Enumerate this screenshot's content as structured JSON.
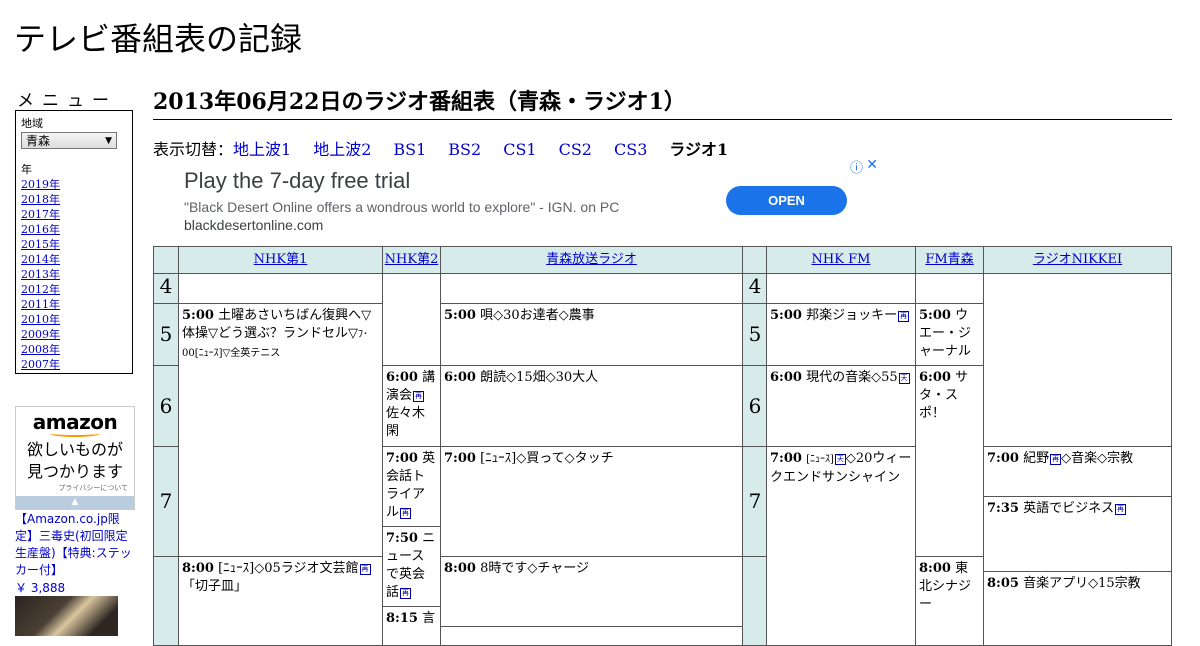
{
  "site_title": "テレビ番組表の記録",
  "menu": {
    "heading": "メニュー",
    "region_label": "地域",
    "region_value": "青森",
    "year_label": "年",
    "years": [
      "2019年",
      "2018年",
      "2017年",
      "2016年",
      "2015年",
      "2014年",
      "2013年",
      "2012年",
      "2011年",
      "2010年",
      "2009年",
      "2008年",
      "2007年"
    ]
  },
  "amazon_ad": {
    "logo": "amazon",
    "copy_line1": "欲しいものが",
    "copy_line2": "見つかります",
    "privacy": "プライバシーについて",
    "product_title": "【Amazon.co.jp限定】三毒史(初回限定生産盤)【特典:ステッカー付】",
    "price": "￥ 3,888"
  },
  "page_heading": "2013年06月22日のラジオ番組表（青森・ラジオ1）",
  "switcher": {
    "label": "表示切替：",
    "links": [
      "地上波1",
      "地上波2",
      "BS1",
      "BS2",
      "CS1",
      "CS2",
      "CS3"
    ],
    "current": "ラジオ1"
  },
  "ad": {
    "headline": "Play the 7-day free trial",
    "text": "\"Black Desert Online offers a wondrous world to explore\" - IGN. on PC",
    "domain": "blackdesertonline.com",
    "button": "OPEN",
    "info_icon": "ⓘ",
    "close_icon": "✕"
  },
  "channels": [
    "NHK第1",
    "NHK第2",
    "青森放送ラジオ",
    "NHK FM",
    "FM青森",
    "ラジオNIKKEI"
  ],
  "hours": [
    "4",
    "5",
    "6",
    "7"
  ],
  "programs": {
    "nhk1_500": {
      "time": "5:00",
      "title": "土曜あさいちばん復興へ▽体操▽どう選ぶ？ランドセル▽",
      "tail": "ﾌ･00[ﾆｭｰｽ]▽全英テニス"
    },
    "nhk1_800": {
      "time": "8:00",
      "title": "[ﾆｭｰｽ]◇05ラジオ文芸館",
      "tail": "「切子皿」",
      "mark": "再"
    },
    "nhk2_600": {
      "time": "6:00",
      "title": "講演会",
      "tail": "佐々木閑",
      "mark": "再"
    },
    "nhk2_700": {
      "time": "7:00",
      "title": "英会話トライアル",
      "mark": "再"
    },
    "nhk2_750": {
      "time": "7:50",
      "title": "ニュースで英会話",
      "mark": "再"
    },
    "nhk2_815": {
      "time": "8:15",
      "title": "言"
    },
    "rab_500": {
      "time": "5:00",
      "title": "唄◇30お達者◇農事"
    },
    "rab_600": {
      "time": "6:00",
      "title": "朗読◇15畑◇30大人"
    },
    "rab_700": {
      "time": "7:00",
      "title": "[ﾆｭｰｽ]◇買って◇タッチ"
    },
    "rab_800": {
      "time": "8:00",
      "title": "8時です◇チャージ"
    },
    "fm_500": {
      "time": "5:00",
      "title": "邦楽ジョッキー",
      "mark": "再"
    },
    "fm_600": {
      "time": "6:00",
      "title": "現代の音楽◇55",
      "mark": "天"
    },
    "fm_700": {
      "time": "7:00",
      "title": "[ﾆｭｰｽ]",
      "mark": "天",
      "tail": "◇20ウィークエンドサンシャイン"
    },
    "fma_500": {
      "time": "5:00",
      "title": "ウエー・ジャーナル"
    },
    "fma_600": {
      "time": "6:00",
      "title": "サタ・スポ！"
    },
    "fma_800": {
      "time": "8:00",
      "title": "東北シナジー"
    },
    "nikkei_700": {
      "time": "7:00",
      "title": "紀野",
      "mark": "再",
      "tail": "◇音楽◇宗教"
    },
    "nikkei_735": {
      "time": "7:35",
      "title": "英語でビジネス",
      "mark": "再"
    },
    "nikkei_805": {
      "time": "8:05",
      "title": "音楽アプリ◇15宗教"
    }
  }
}
